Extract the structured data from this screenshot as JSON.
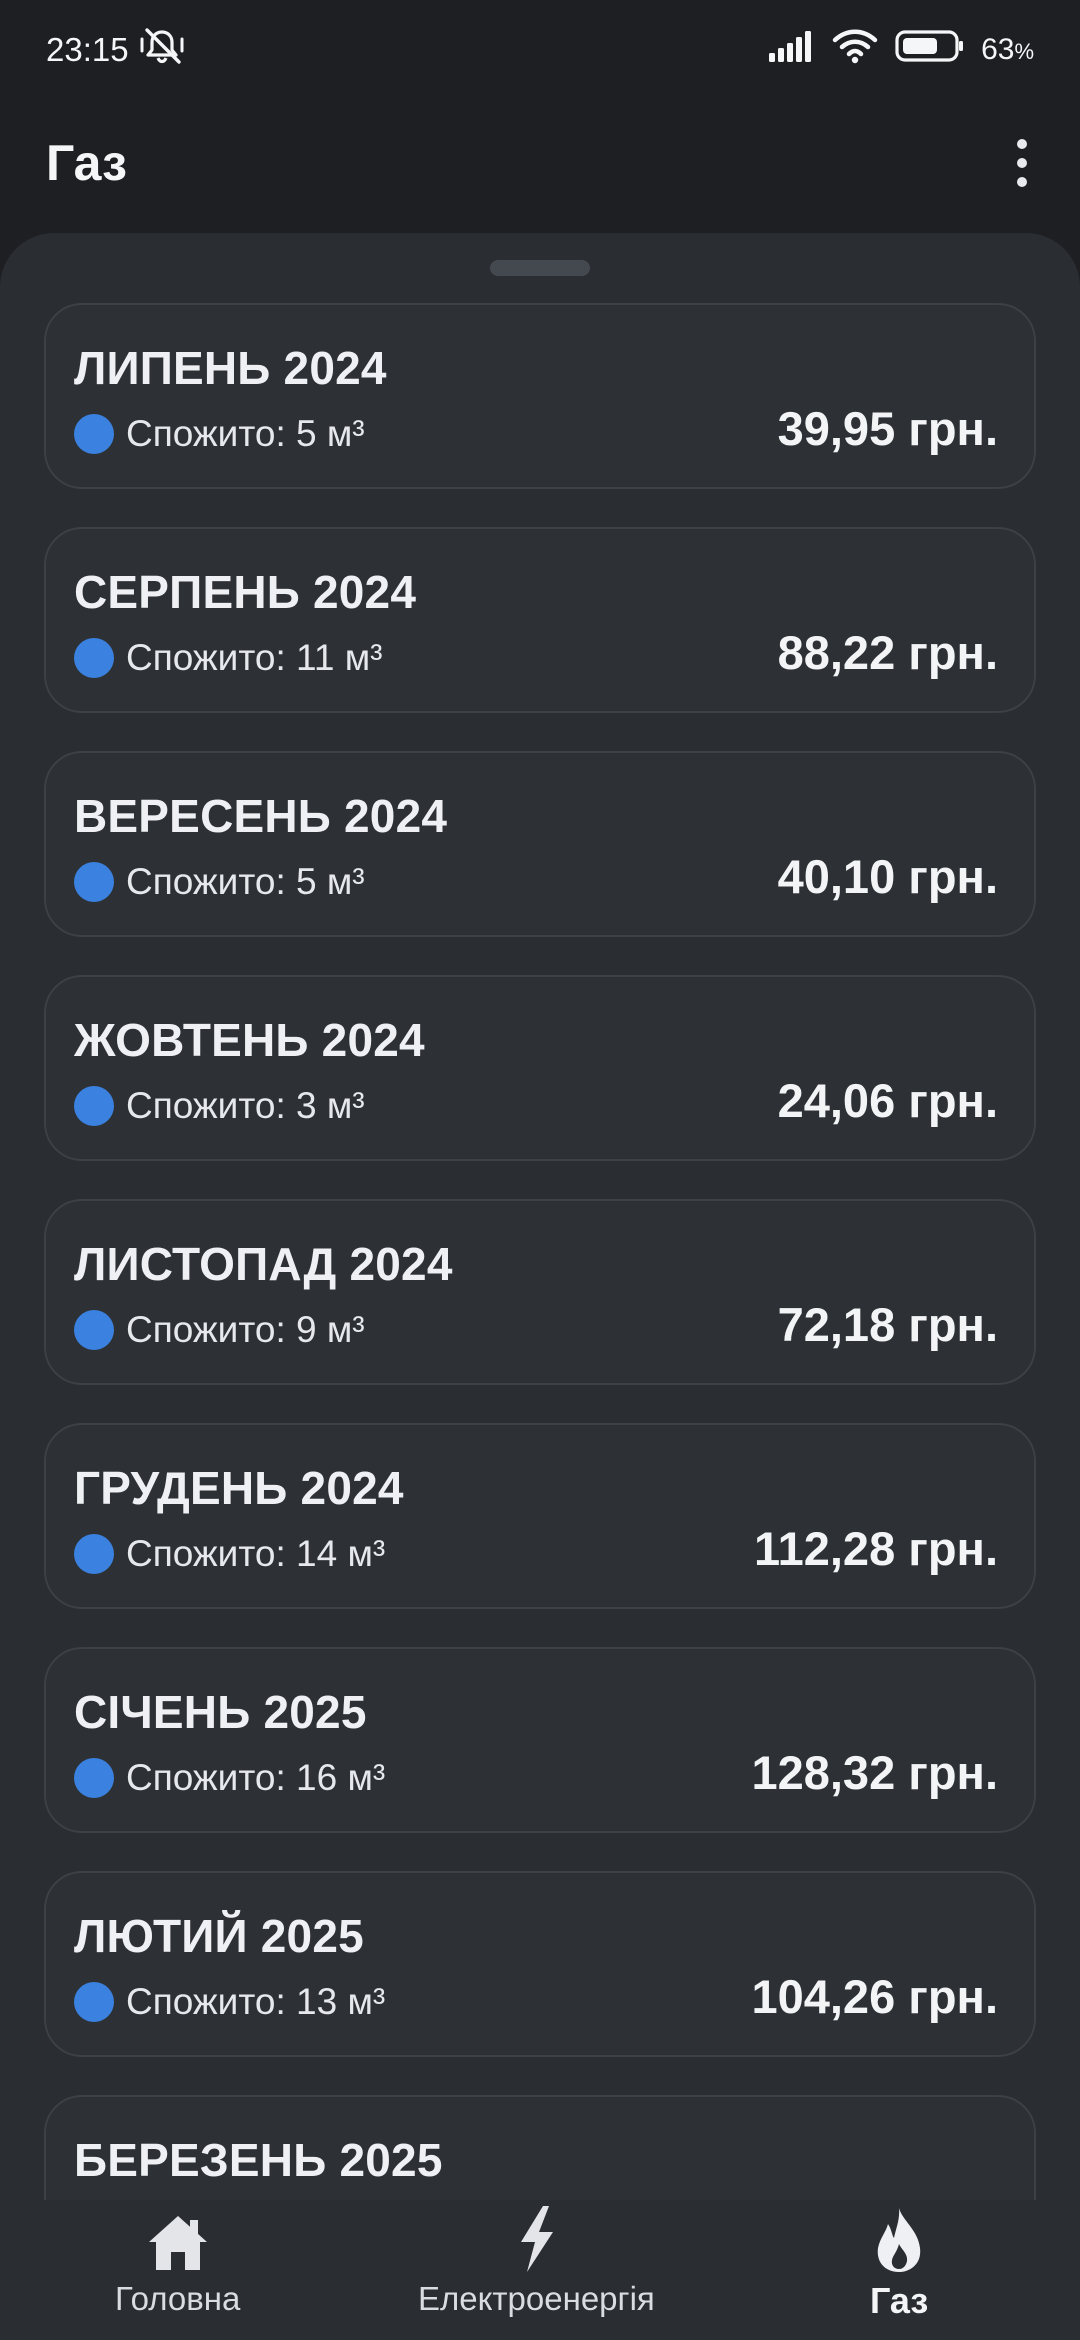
{
  "status_bar": {
    "time": "23:15",
    "battery_percent": "63",
    "battery_unit": "%"
  },
  "app_bar": {
    "title": "Газ",
    "menu_icon": "more-vert-icon"
  },
  "entries": [
    {
      "month": "ЛИПЕНЬ 2024",
      "usage": "Спожито: 5 м³",
      "amount": "39,95 грн."
    },
    {
      "month": "СЕРПЕНЬ 2024",
      "usage": "Спожито: 11 м³",
      "amount": "88,22 грн."
    },
    {
      "month": "ВЕРЕСЕНЬ 2024",
      "usage": "Спожито: 5 м³",
      "amount": "40,10 грн."
    },
    {
      "month": "ЖОВТЕНЬ 2024",
      "usage": "Спожито: 3 м³",
      "amount": "24,06 грн."
    },
    {
      "month": "ЛИСТОПАД 2024",
      "usage": "Спожито: 9 м³",
      "amount": "72,18 грн."
    },
    {
      "month": "ГРУДЕНЬ 2024",
      "usage": "Спожито: 14 м³",
      "amount": "112,28 грн."
    },
    {
      "month": "СІЧЕНЬ 2025",
      "usage": "Спожито: 16 м³",
      "amount": "128,32 грн."
    },
    {
      "month": "ЛЮТИЙ 2025",
      "usage": "Спожито: 13 м³",
      "amount": "104,26 грн."
    },
    {
      "month": "БЕРЕЗЕНЬ 2025",
      "usage": "",
      "amount": ""
    }
  ],
  "bottom_nav": [
    {
      "label": "Головна",
      "icon": "home-icon",
      "active": false
    },
    {
      "label": "Електроенергія",
      "icon": "lightning-icon",
      "active": false
    },
    {
      "label": "Газ",
      "icon": "flame-icon",
      "active": true
    }
  ],
  "colors": {
    "background": "#1d1f23",
    "surface": "#2a2d32",
    "accent_dot": "#3b82e0"
  }
}
